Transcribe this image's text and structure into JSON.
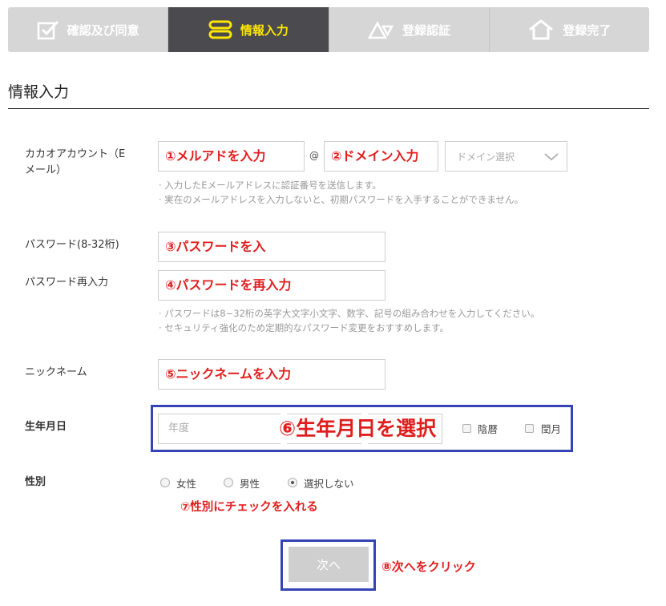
{
  "steps": [
    {
      "label": "確認及び同意",
      "icon": "checkbox-icon",
      "active": false
    },
    {
      "label": "情報入力",
      "icon": "input-icon",
      "active": true
    },
    {
      "label": "登録認証",
      "icon": "shapes-icon",
      "active": false
    },
    {
      "label": "登録完了",
      "icon": "house-icon",
      "active": false
    }
  ],
  "section_title": "情報入力",
  "account": {
    "label_line1": "カカオアカウント（E",
    "label_line2": "メール）",
    "email_value": "①メルアドを入力",
    "at": "@",
    "domain_value": "②ドメイン入力",
    "domain_select": "ドメイン選択",
    "note1": "· 入力したEメールアドレスに認証番号を送信します。",
    "note2": "· 実在のメールアドレスを入力しないと、初期パスワードを入手することができません。"
  },
  "password": {
    "label": "パスワード(8-32桁)",
    "value": "③パスワードを入",
    "re_label": "パスワード再入力",
    "re_value": "④パスワードを再入力",
    "note1": "· パスワードは8~32桁の英字大文字小文字、数字、記号の組み合わせを入力してください。",
    "note2": "· セキュリティ強化のため定期的なパスワード変更をおすすめします。"
  },
  "nickname": {
    "label": "ニックネーム",
    "value": "⑤ニックネームを入力"
  },
  "birthday": {
    "label": "生年月日",
    "year_placeholder": "年度",
    "annotation": "⑥生年月日を選択",
    "lunar": "陰暦",
    "leap": "閏月"
  },
  "gender": {
    "label": "性別",
    "options": [
      {
        "label": "女性",
        "selected": false
      },
      {
        "label": "男性",
        "selected": false
      },
      {
        "label": "選択しない",
        "selected": true
      }
    ],
    "annotation": "⑦性別にチェックを入れる"
  },
  "next": {
    "label": "次へ",
    "annotation": "⑧次へをクリック"
  },
  "colors": {
    "accent_yellow": "#ffe600",
    "annotation_red": "#e01e1e",
    "highlight_blue": "#3444b4"
  }
}
